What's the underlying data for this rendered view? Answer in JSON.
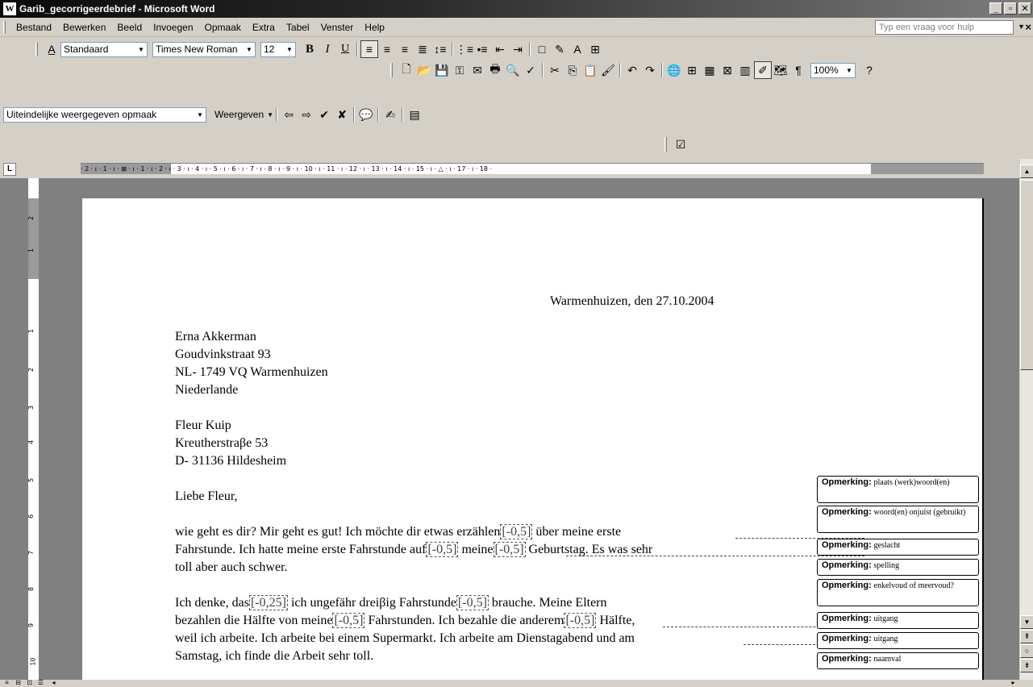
{
  "window": {
    "title": "Garib_gecorrigeerdebrief - Microsoft Word",
    "app_icon": "word-icon",
    "buttons": {
      "minimize": "_",
      "restore": "▫",
      "close": "✕"
    }
  },
  "menu": {
    "items": [
      "Bestand",
      "Bewerken",
      "Beeld",
      "Invoegen",
      "Opmaak",
      "Extra",
      "Tabel",
      "Venster",
      "Help"
    ],
    "help_placeholder": "Typ een vraag voor hulp",
    "close": "×"
  },
  "formatting_toolbar": {
    "style": "Standaard",
    "font": "Times New Roman",
    "size": "12",
    "bold": "B",
    "italic": "I",
    "underline": "U"
  },
  "standard_toolbar": {
    "zoom": "100%",
    "pilcrow": "¶",
    "help": "?"
  },
  "reviewing_toolbar": {
    "display_mode": "Uiteindelijke weergegeven opmaak",
    "show_label": "Weergeven"
  },
  "ruler": {
    "tab_selector": "L",
    "ticks": "· 2 · ı · 1 · ı · ⊠ · ı · 1 · ı · 2 · ı · 3 · ı · 4 · ı · 5 · ı · 6 · ı · 7 · ı · 8 · ı · 9 · ı · 10 · ı · 11 · ı · 12 · ı · 13 · ı · 14 · ı · 15 · ı · △ · ı · 17 · ı · 18 ·",
    "vertical_numbers": [
      "2",
      "1",
      "1",
      "2",
      "3",
      "4",
      "5",
      "6",
      "7",
      "8",
      "9",
      "10"
    ]
  },
  "document": {
    "date_line": "Warmenhuizen, den 27.10.2004",
    "sender": [
      "Erna Akkerman",
      "Goudvinkstraat 93",
      "NL- 1749 VQ Warmenhuizen",
      "Niederlande"
    ],
    "recipient": [
      "Fleur Kuip",
      "Kreutherstraβe 53",
      "D- 31136 Hildesheim"
    ],
    "greeting": "Liebe Fleur,",
    "p1": {
      "l1_a": "wie geht es dir? Mir geht es gut! Ich möchte dir etwas erzählen",
      "l1_mark": "[-0,5]",
      "l1_b": " über meine erste",
      "l2_a": "Fahrstunde. Ich hatte meine erste Fahrstunde auf",
      "l2_mark1": "[-0,5]",
      "l2_b": " meine",
      "l2_mark2": "[-0,5]",
      "l2_c": " Geburtstag. Es was sehr",
      "l3": "toll aber auch schwer."
    },
    "p2": {
      "l1_a": "Ich denke,  das",
      "l1_mark1": "[-0,25]",
      "l1_b": " ich ungefähr dreiβig Fahrstunde",
      "l1_mark2": "[-0,5]",
      "l1_c": " brauche. Meine Eltern",
      "l2_a": "bezahlen die Hälfte von meine",
      "l2_mark1": "[-0,5]",
      "l2_b": " Fahrstunden. Ich bezahle die anderem",
      "l2_mark2": "[-0,5]",
      "l2_c": " Hälfte,",
      "l3": "weil ich arbeite. Ich arbeite bei einem Supermarkt. Ich arbeite am Dienstagabend und am",
      "l4": "Samstag, ich finde die Arbeit sehr toll."
    }
  },
  "comments": [
    {
      "label": "Opmerking:",
      "text": "plaats (werk)woord(en)"
    },
    {
      "label": "Opmerking:",
      "text": "woord(en) onjuist (gebruikt)"
    },
    {
      "label": "Opmerking:",
      "text": "geslacht"
    },
    {
      "label": "Opmerking:",
      "text": "spelling"
    },
    {
      "label": "Opmerking:",
      "text": "enkelvoud of meervoud?"
    },
    {
      "label": "Opmerking:",
      "text": "uitgang"
    },
    {
      "label": "Opmerking:",
      "text": "uitgang"
    },
    {
      "label": "Opmerking:",
      "text": "naamval"
    }
  ]
}
